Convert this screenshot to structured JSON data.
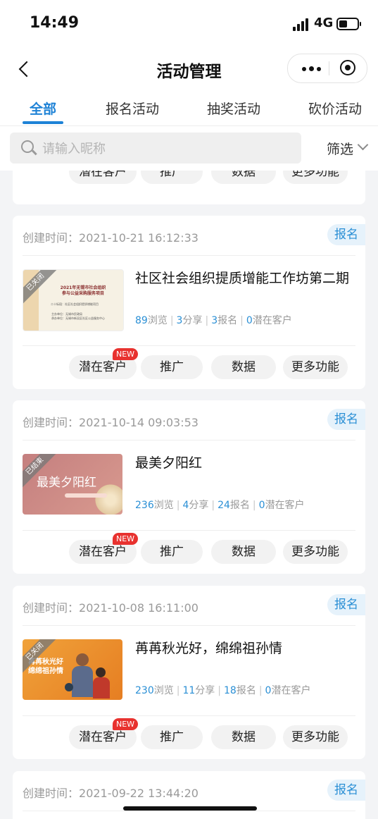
{
  "status_bar": {
    "time": "14:49",
    "network": "4G"
  },
  "nav": {
    "title": "活动管理"
  },
  "tabs": [
    {
      "label": "全部",
      "active": true
    },
    {
      "label": "报名活动",
      "active": false
    },
    {
      "label": "抽奖活动",
      "active": false
    },
    {
      "label": "砍价活动",
      "active": false
    }
  ],
  "search": {
    "placeholder": "请输入昵称"
  },
  "filter": {
    "label": "筛选"
  },
  "buttons": {
    "potential": "潜在客户",
    "promote": "推广",
    "data": "数据",
    "more": "更多功能",
    "new_badge": "NEW"
  },
  "colors": {
    "accent": "#1e82d6",
    "number": "#2a8fd5",
    "badge": "#e8322f"
  },
  "partial_card": {
    "buttons": [
      "潜在客户",
      "推广",
      "数据",
      "更多功能"
    ]
  },
  "cards": [
    {
      "created_label": "创建时间：",
      "created_at": "2021-10-21 16:12:33",
      "tag": "报名",
      "title": "社区社会组织提质增能工作坊第二期",
      "thumb_ribbon": "已关闭",
      "thumb_lines": [
        "2021年无锡市社会组织",
        "参与公益采购服务项目",
        "二十标段：社区社会组织提质增能项目",
        "主办单位：无锡市民政局",
        "承办单位：无锡市新吴区社区公益服务中心"
      ],
      "views": "89",
      "views_label": "浏览",
      "shares": "3",
      "shares_label": "分享",
      "signups": "3",
      "signups_label": "报名",
      "potential": "0",
      "potential_label": "潜在客户"
    },
    {
      "created_label": "创建时间：",
      "created_at": "2021-10-14 09:03:53",
      "tag": "报名",
      "title": "最美夕阳红",
      "thumb_ribbon": "已结束",
      "thumb_text": "最美夕阳红",
      "views": "236",
      "views_label": "浏览",
      "shares": "4",
      "shares_label": "分享",
      "signups": "24",
      "signups_label": "报名",
      "potential": "0",
      "potential_label": "潜在客户"
    },
    {
      "created_label": "创建时间：",
      "created_at": "2021-10-08 16:11:00",
      "tag": "报名",
      "title": "苒苒秋光好，绵绵祖孙情",
      "thumb_ribbon": "已关闭",
      "thumb_lines": [
        "苒苒秋光好",
        "绵绵祖孙情"
      ],
      "views": "230",
      "views_label": "浏览",
      "shares": "11",
      "shares_label": "分享",
      "signups": "18",
      "signups_label": "报名",
      "potential": "0",
      "potential_label": "潜在客户"
    }
  ],
  "last_card": {
    "created_label": "创建时间：",
    "created_at": "2021-09-22 13:44:20",
    "tag": "报名"
  }
}
